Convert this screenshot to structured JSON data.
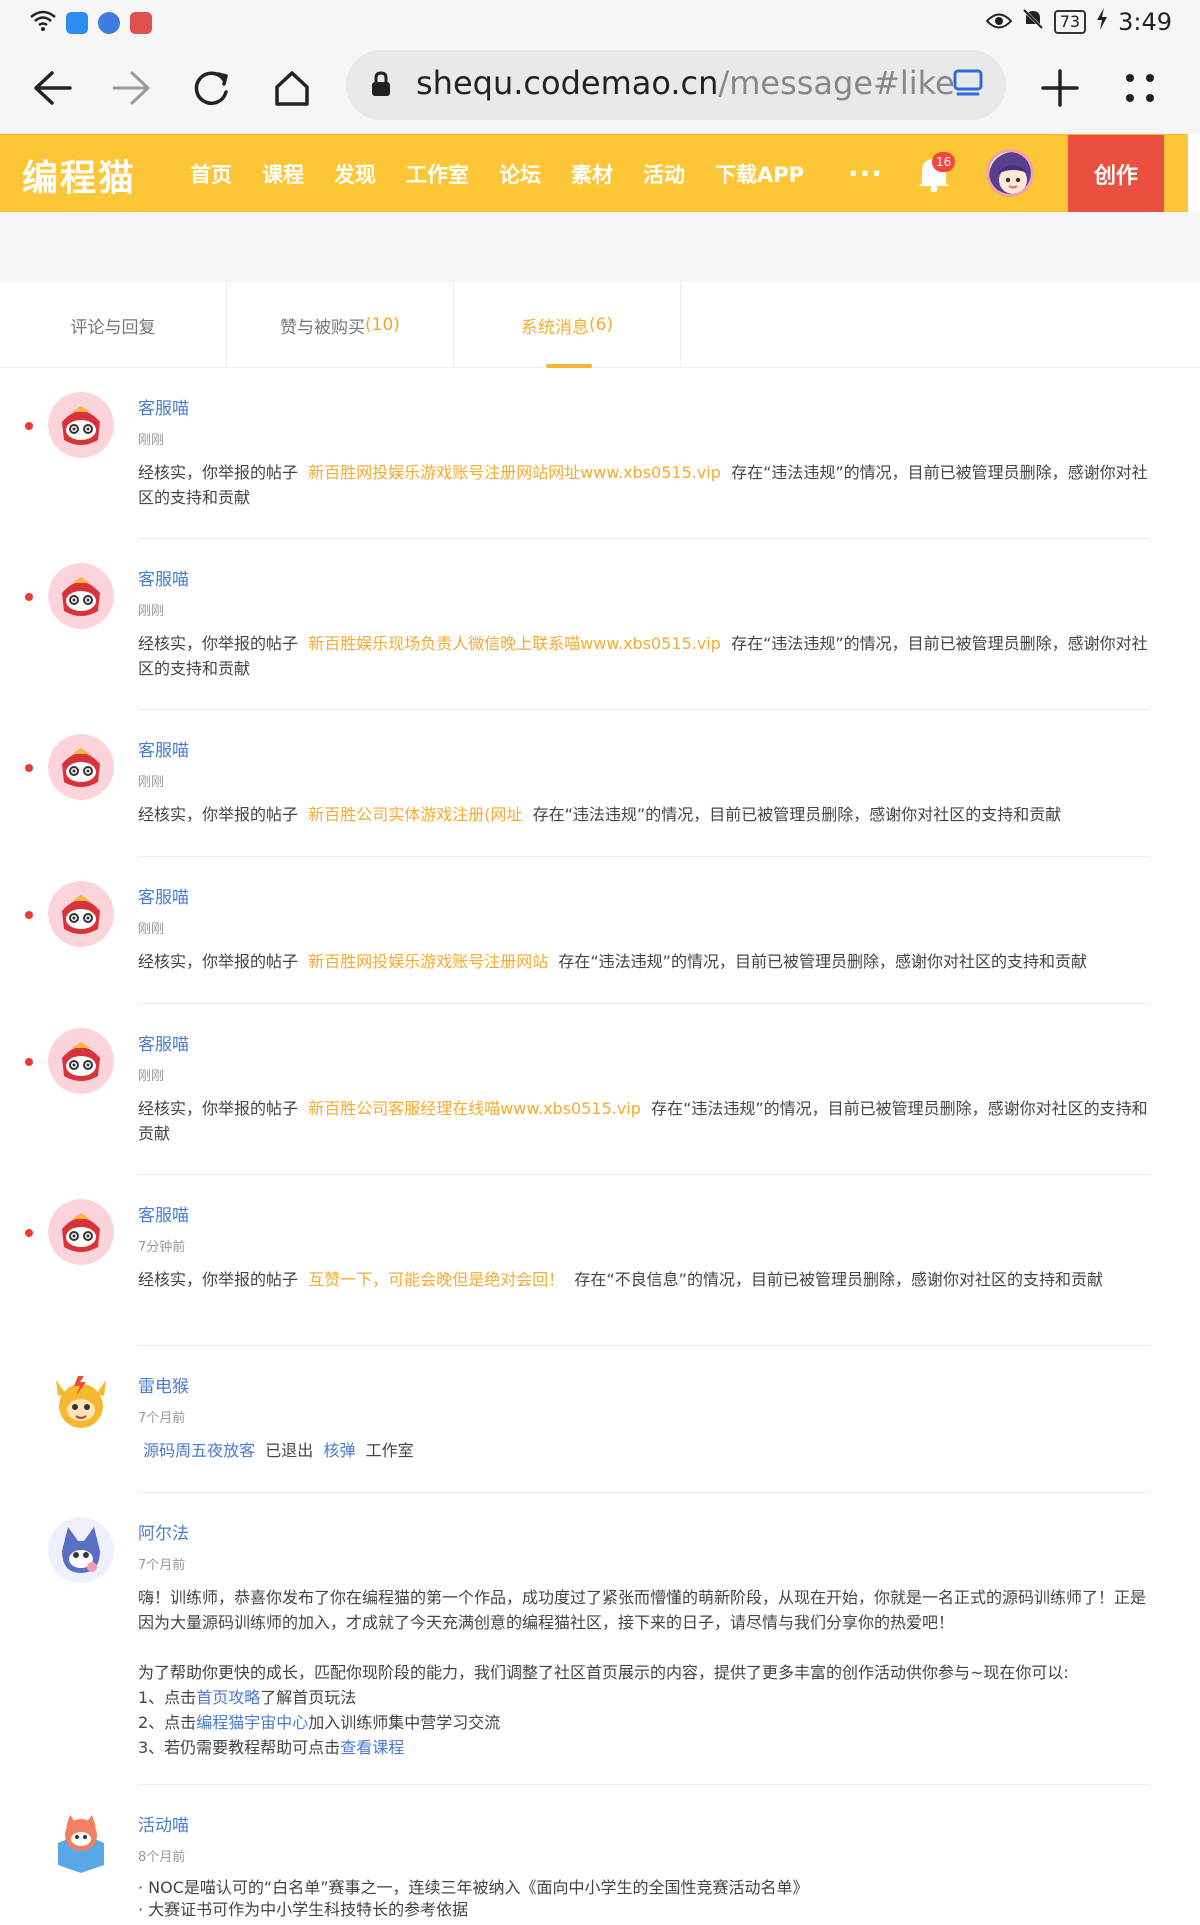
{
  "status_bar": {
    "battery": "73",
    "time": "3:49"
  },
  "browser": {
    "url_host": "shequ.codemao.cn",
    "url_path": "/message#like"
  },
  "header": {
    "logo": "编程猫",
    "nav": [
      "首页",
      "课程",
      "发现",
      "工作室",
      "论坛",
      "素材",
      "活动",
      "下载APP"
    ],
    "more": "···",
    "notification_count": "16",
    "create_label": "创作",
    "accent_color": "#fcc636"
  },
  "tabs": [
    {
      "label": "评论与回复",
      "count": ""
    },
    {
      "label": "赞与被购买",
      "count": "(10)"
    },
    {
      "label": "系统消息",
      "count": "(6)"
    }
  ],
  "messages": [
    {
      "sender": "客服喵",
      "time": "刚刚",
      "prefix": "经核实，你举报的帖子",
      "post": "新百胜网投娱乐游戏账号注册网站网址www.xbs0515.vip",
      "suffix": "存在“违法违规”的情况，目前已被管理员删除，感谢你对社区的支持和贡献"
    },
    {
      "sender": "客服喵",
      "time": "刚刚",
      "prefix": "经核实，你举报的帖子",
      "post": "新百胜娱乐现场负责人微信晚上联系喵www.xbs0515.vip",
      "suffix": "存在“违法违规”的情况，目前已被管理员删除，感谢你对社区的支持和贡献"
    },
    {
      "sender": "客服喵",
      "time": "刚刚",
      "prefix": "经核实，你举报的帖子",
      "post": "新百胜公司实体游戏注册(网址",
      "suffix": "存在“违法违规”的情况，目前已被管理员删除，感谢你对社区的支持和贡献"
    },
    {
      "sender": "客服喵",
      "time": "刚刚",
      "prefix": "经核实，你举报的帖子",
      "post": "新百胜网投娱乐游戏账号注册网站",
      "suffix": "存在“违法违规”的情况，目前已被管理员删除，感谢你对社区的支持和贡献"
    },
    {
      "sender": "客服喵",
      "time": "刚刚",
      "prefix": "经核实，你举报的帖子",
      "post": "新百胜公司客服经理在线喵www.xbs0515.vip",
      "suffix": "存在“违法违规”的情况，目前已被管理员删除，感谢你对社区的支持和贡献"
    },
    {
      "sender": "客服喵",
      "time": "7分钟前",
      "prefix": "经核实，你举报的帖子",
      "post": "互赞一下，可能会晚但是绝对会回！",
      "suffix": "存在“不良信息”的情况，目前已被管理员删除，感谢你对社区的支持和贡献"
    }
  ],
  "studio_msg": {
    "sender": "雷电猴",
    "time": "7个月前",
    "user": "源码周五夜放客",
    "action": "已退出",
    "studio": "核弹",
    "tail": "工作室"
  },
  "welcome_msg": {
    "sender": "阿尔法",
    "time": "7个月前",
    "para1": "嗨！训练师，恭喜你发布了你在编程猫的第一个作品，成功度过了紧张而懵懂的萌新阶段，从现在开始，你就是一名正式的源码训练师了！正是因为大量源码训练师的加入，才成就了今天充满创意的编程猫社区，接下来的日子，请尽情与我们分享你的热爱吧！",
    "para2": "为了帮助你更快的成长，匹配你现阶段的能力，我们调整了社区首页展示的内容，提供了更多丰富的创作活动供你参与~现在你可以:",
    "item1_pre": "1、点击",
    "item1_link": "首页攻略",
    "item1_post": "了解首页玩法",
    "item2_pre": "2、点击",
    "item2_link": "编程猫宇宙中心",
    "item2_post": "加入训练师集中营学习交流",
    "item3_pre": "3、若仍需要教程帮助可点击",
    "item3_link": "查看课程"
  },
  "activity_msg": {
    "sender": "活动喵",
    "time": "8个月前",
    "line1": "· NOC是喵认可的“白名单”赛事之一，连续三年被纳入《面向中小学生的全国性竞赛活动名单》",
    "line2": "· 大赛证书可作为中小学生科技特长的参考依据"
  }
}
